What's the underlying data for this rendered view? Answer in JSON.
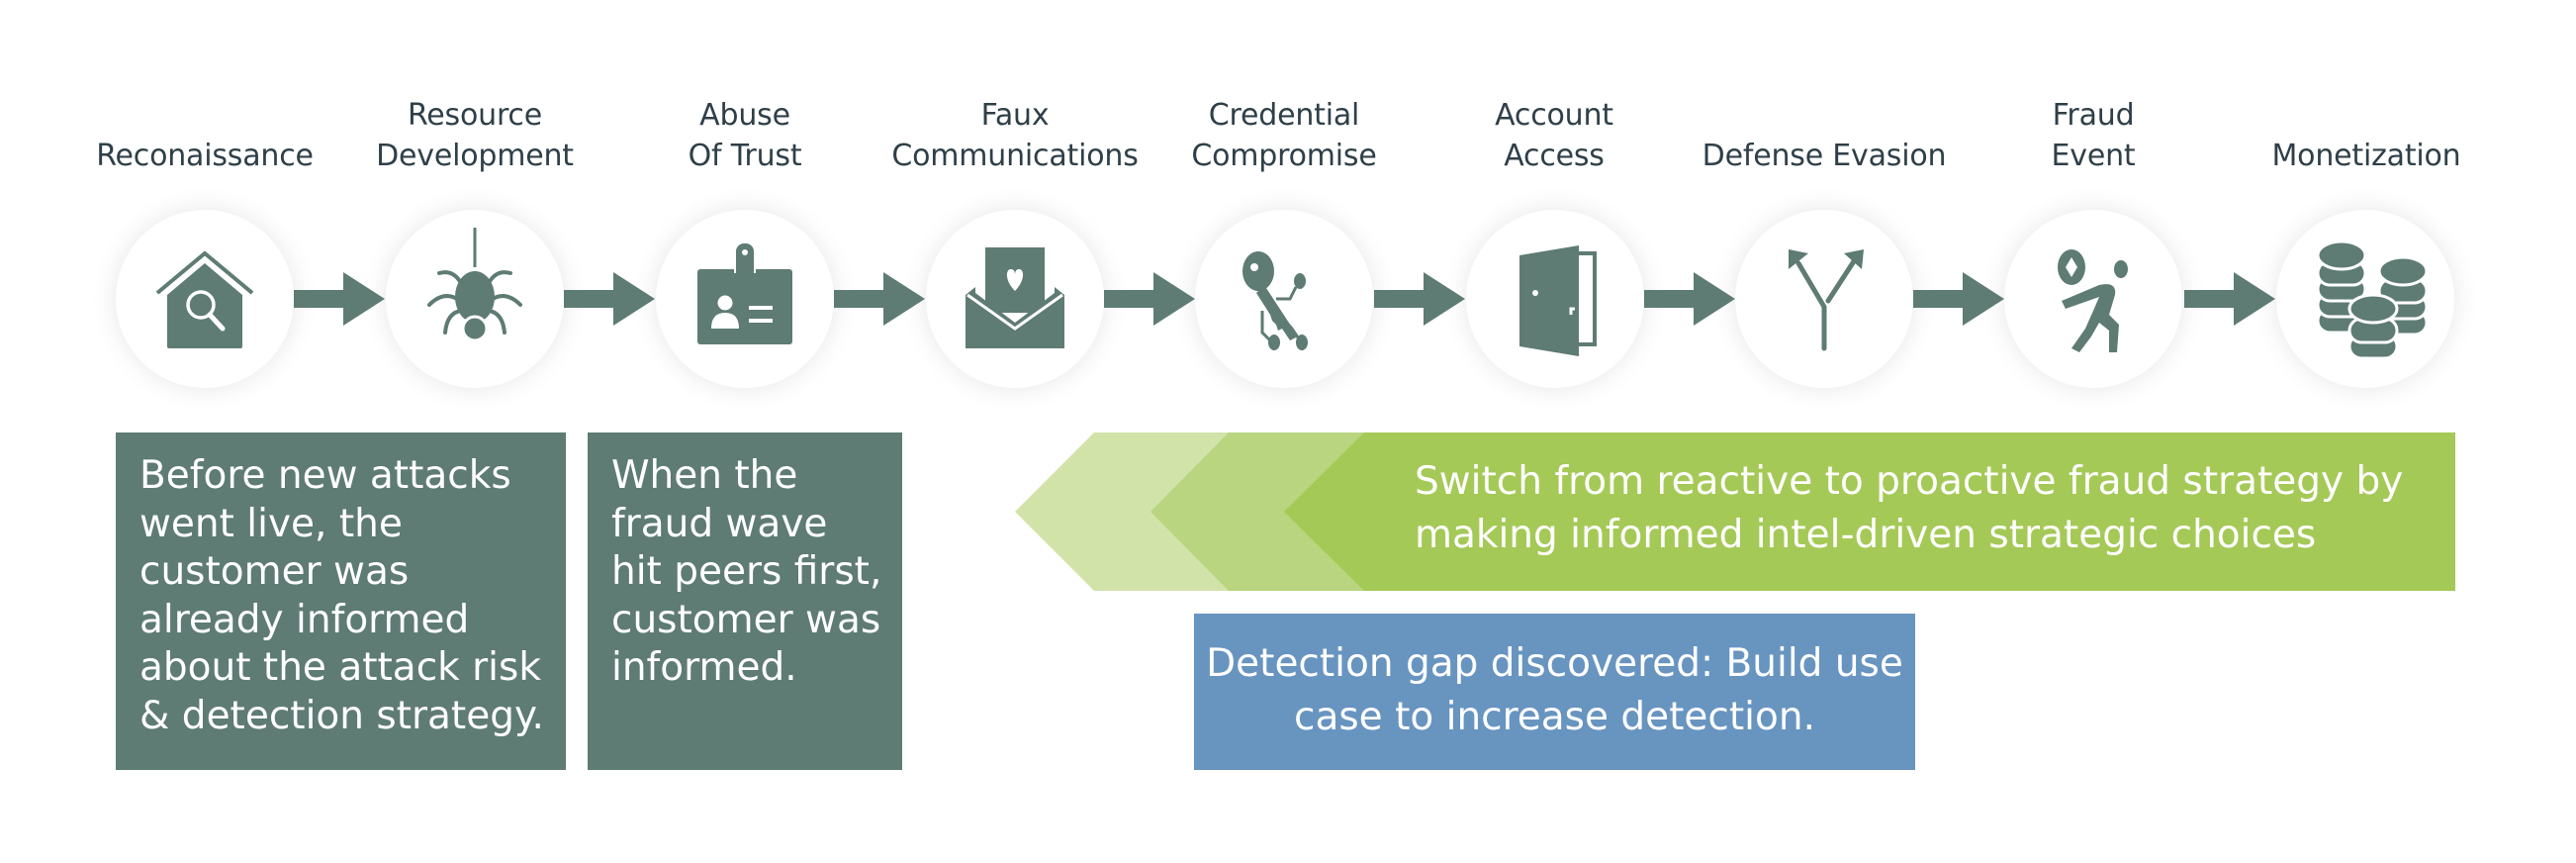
{
  "stages": [
    {
      "lines": [
        "",
        "Reconaissance"
      ],
      "icon": "house-search-icon"
    },
    {
      "lines": [
        "Resource",
        "Development"
      ],
      "icon": "spider-icon"
    },
    {
      "lines": [
        "Abuse",
        "Of Trust"
      ],
      "icon": "id-badge-icon"
    },
    {
      "lines": [
        "Faux",
        "Communications"
      ],
      "icon": "envelope-heart-icon"
    },
    {
      "lines": [
        "Credential",
        "Compromise"
      ],
      "icon": "digital-key-icon"
    },
    {
      "lines": [
        "Account",
        "Access"
      ],
      "icon": "open-door-icon"
    },
    {
      "lines": [
        "",
        "Defense Evasion"
      ],
      "icon": "split-arrows-icon"
    },
    {
      "lines": [
        "Fraud",
        "Event"
      ],
      "icon": "thief-running-icon"
    },
    {
      "lines": [
        "",
        "Monetization"
      ],
      "icon": "coin-stacks-icon"
    }
  ],
  "boxes": {
    "early": "Before new attacks went live, the customer was already informed about the attack risk & detection strategy.",
    "peers": "When the fraud wave hit peers first, customer was informed.",
    "gap": "Detection gap discovered: Build use case to increase detection."
  },
  "banner": {
    "text": "Switch from reactive to proactive fraud strategy by making informed intel-driven strategic choices"
  },
  "colors": {
    "icon": "#5e7b74",
    "teal_box": "#5e7b74",
    "blue_box": "#6894c0",
    "green_dark": "#a5c957",
    "green_mid": "#b9d580",
    "green_light": "#d2e3aa",
    "label_text": "#2f3f48"
  }
}
